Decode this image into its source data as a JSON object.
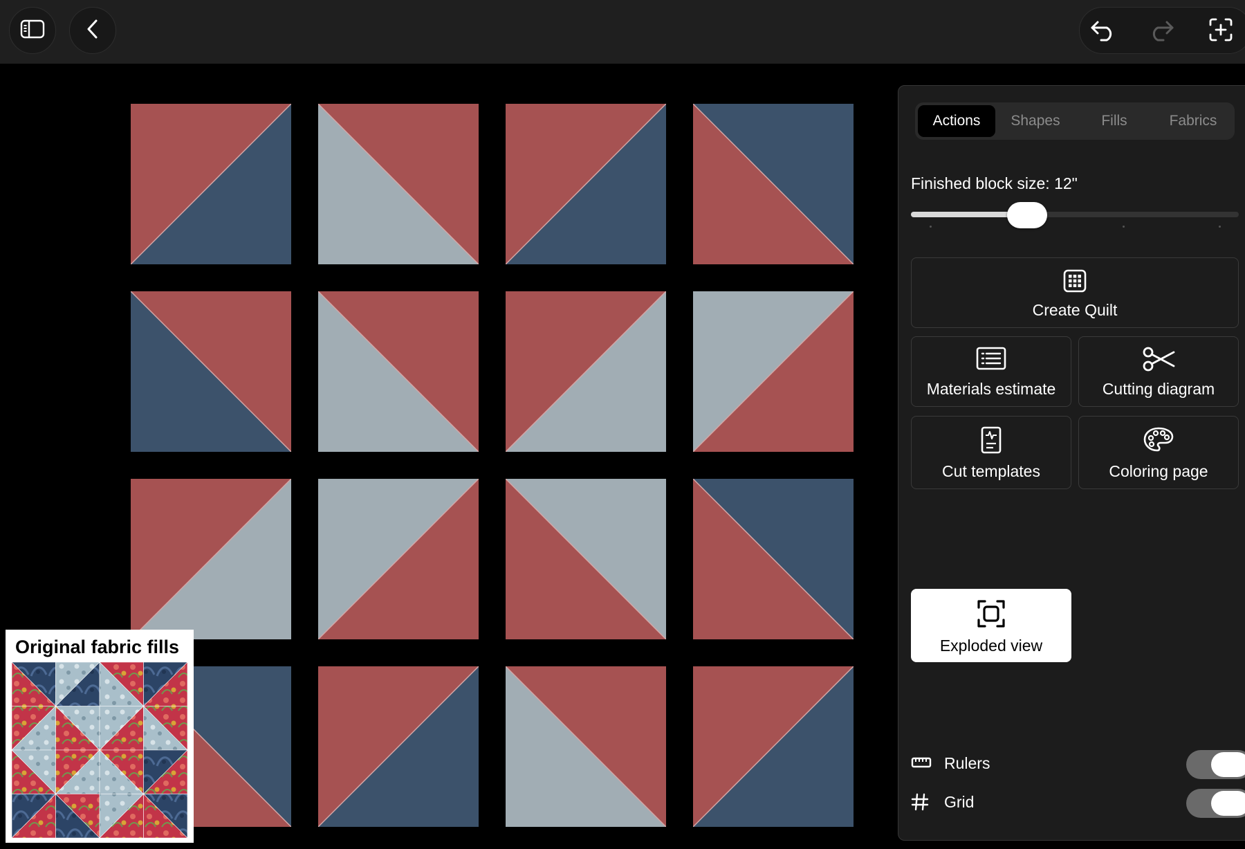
{
  "toolbar": {
    "left": [
      {
        "icon": "sidebar-toggle-icon"
      },
      {
        "icon": "back-chevron-icon"
      }
    ],
    "right": [
      {
        "icon": "undo-icon"
      },
      {
        "icon": "redo-icon",
        "disabled": true
      },
      {
        "icon": "add-frame-icon"
      }
    ]
  },
  "colors": {
    "red": "#a65252",
    "navy": "#3c526b",
    "light": "#a1adb4",
    "seam": "#d3a7a7",
    "panel": "#1c1c1c",
    "topbar": "#1f1f1f"
  },
  "quilt": {
    "rows": 4,
    "cols": 4,
    "blocks": [
      [
        "bl",
        "tr",
        "red",
        "navy"
      ],
      [
        "br",
        "tl",
        "red",
        "light"
      ],
      [
        "bl",
        "tr",
        "red",
        "navy"
      ],
      [
        "br",
        "tl",
        "navy",
        "red"
      ],
      [
        "br",
        "tl",
        "red",
        "navy"
      ],
      [
        "br",
        "tl",
        "red",
        "light"
      ],
      [
        "bl",
        "tr",
        "red",
        "light"
      ],
      [
        "bl",
        "tr",
        "light",
        "red"
      ],
      [
        "bl",
        "tr",
        "red",
        "light"
      ],
      [
        "bl",
        "tr",
        "light",
        "red"
      ],
      [
        "br",
        "tl",
        "light",
        "red"
      ],
      [
        "br",
        "tl",
        "navy",
        "red"
      ],
      [
        "br",
        "tl",
        "navy",
        "red"
      ],
      [
        "bl",
        "tr",
        "red",
        "navy"
      ],
      [
        "br",
        "tl",
        "red",
        "light"
      ],
      [
        "bl",
        "tr",
        "red",
        "navy"
      ]
    ]
  },
  "inset": {
    "title": "Original fabric fills"
  },
  "panel": {
    "tabs": [
      {
        "label": "Actions",
        "active": true
      },
      {
        "label": "Shapes"
      },
      {
        "label": "Fills"
      },
      {
        "label": "Fabrics"
      }
    ],
    "block_size_label": "Finished block size: 12\"",
    "slider": {
      "value": 0.355,
      "ticks": 4
    },
    "actions": [
      {
        "label": "Create Quilt",
        "icon": "grid-quilt-icon"
      },
      {
        "label": "Materials estimate",
        "icon": "list-document-icon"
      },
      {
        "label": "Cutting diagram",
        "icon": "scissors-icon"
      },
      {
        "label": "Cut templates",
        "icon": "template-page-icon"
      },
      {
        "label": "Coloring page",
        "icon": "palette-icon"
      }
    ],
    "exploded_view": {
      "label": "Exploded view",
      "icon": "focus-frame-icon"
    },
    "toggles": [
      {
        "label": "Rulers",
        "icon": "ruler-icon",
        "on": true
      },
      {
        "label": "Grid",
        "icon": "hash-icon",
        "on": true
      }
    ]
  }
}
